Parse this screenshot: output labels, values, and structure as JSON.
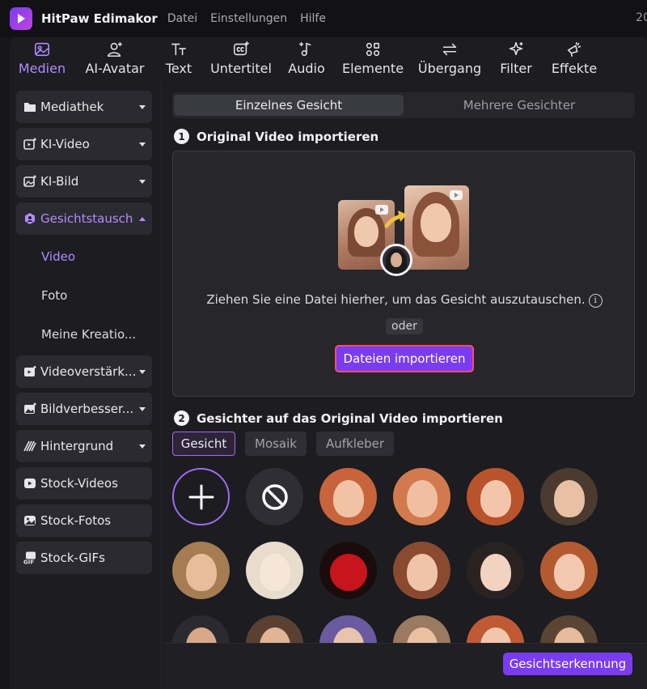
{
  "titlebar": {
    "app_name": "HitPaw Edimakor",
    "menu": [
      "Datei",
      "Einstellungen",
      "Hilfe"
    ],
    "right_text": "20"
  },
  "toolbar": {
    "items": [
      {
        "label": "Medien",
        "icon": "media-icon",
        "active": true
      },
      {
        "label": "AI-Avatar",
        "icon": "avatar-icon"
      },
      {
        "label": "Text",
        "icon": "text-icon"
      },
      {
        "label": "Untertitel",
        "icon": "subtitle-icon"
      },
      {
        "label": "Audio",
        "icon": "music-icon"
      },
      {
        "label": "Elemente",
        "icon": "elements-icon"
      },
      {
        "label": "Übergang",
        "icon": "transition-icon"
      },
      {
        "label": "Filter",
        "icon": "filter-icon"
      },
      {
        "label": "Effekte",
        "icon": "effects-icon"
      }
    ]
  },
  "sidebar": {
    "items": [
      {
        "label": "Mediathek",
        "icon": "folder-icon"
      },
      {
        "label": "KI-Video",
        "icon": "ai-video-icon"
      },
      {
        "label": "KI-Bild",
        "icon": "ai-image-icon"
      },
      {
        "label": "Gesichtstausch",
        "icon": "face-swap-icon",
        "active": true
      },
      {
        "label": "Videoverstärk...",
        "icon": "video-enhance-icon"
      },
      {
        "label": "Bildverbesser...",
        "icon": "image-enhance-icon"
      },
      {
        "label": "Hintergrund",
        "icon": "background-icon"
      },
      {
        "label": "Stock-Videos",
        "icon": "stock-video-icon"
      },
      {
        "label": "Stock-Fotos",
        "icon": "stock-photo-icon"
      },
      {
        "label": "Stock-GIFs",
        "icon": "gif-icon"
      }
    ],
    "subitems": [
      "Video",
      "Foto",
      "Meine Kreatio..."
    ]
  },
  "main": {
    "tabs": [
      "Einzelnes Gesicht",
      "Mehrere Gesichter"
    ],
    "step1": {
      "number": "1",
      "title": "Original Video importieren"
    },
    "drop_text": "Ziehen Sie eine Datei hierher, um das Gesicht auszutauschen.",
    "or_label": "oder",
    "import_button": "Dateien importieren",
    "step2": {
      "number": "2",
      "title": "Gesichter auf das Original Video importieren"
    },
    "face_tabs": [
      "Gesicht",
      "Mosaik",
      "Aufkleber"
    ],
    "detect_button": "Gesichtserkennung"
  },
  "colors": {
    "accent": "#7a3cf0",
    "accent_text": "#b38cff",
    "panel": "#1c1c21",
    "highlight_border": "#ff4a6e"
  }
}
